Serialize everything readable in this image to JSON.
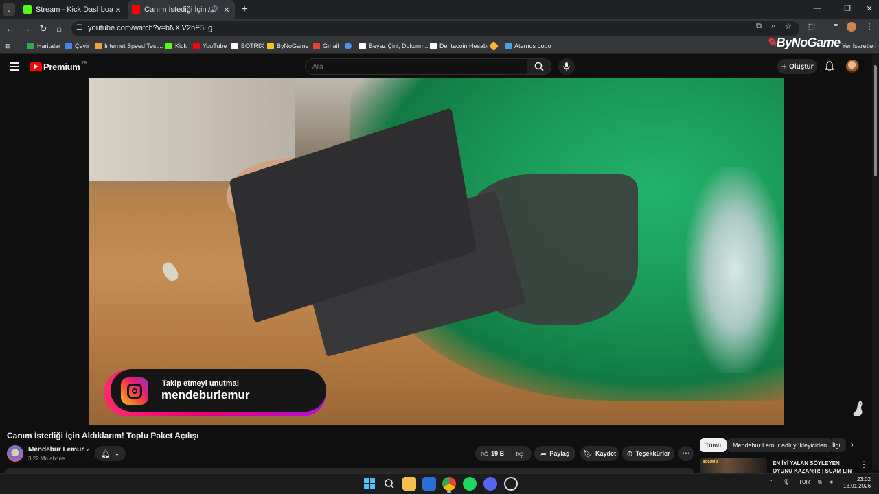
{
  "browser": {
    "tabs": [
      {
        "title": "Stream - Kick Dashboard",
        "favicon_color": "#53fc18"
      },
      {
        "title": "Canım İstediği İçin Aldıklarım!",
        "favicon_color": "#ff0000"
      }
    ],
    "url": "youtube.com/watch?v=bNXiV2hF5Lg",
    "bookmarks": [
      {
        "label": "Haritalar",
        "icon_color": "#34a853"
      },
      {
        "label": "Çevir",
        "icon_color": "#4285f4"
      },
      {
        "label": "Internet Speed Test...",
        "icon_color": "#f4a340"
      },
      {
        "label": "Kick",
        "icon_color": "#53fc18"
      },
      {
        "label": "YouTube",
        "icon_color": "#ff0000"
      },
      {
        "label": "BOTRIX",
        "icon_color": "#ffffff"
      },
      {
        "label": "ByNoGame",
        "icon_color": "#f5c518"
      },
      {
        "label": "Gmail",
        "icon_color": "#ea4335"
      },
      {
        "label": "",
        "icon_color": "#4f8ff0"
      },
      {
        "label": "Beyaz Çini, Dokunm...",
        "icon_color": "#ffffff"
      },
      {
        "label": "Dentacoin Hesabı",
        "icon_color": "#ffffff"
      },
      {
        "label": "",
        "icon_color": "#f3ba2f"
      },
      {
        "label": "Aternos Logo",
        "icon_color": "#4aa3df"
      }
    ],
    "bynogame_logo": "ByNoGame",
    "other_bookmarks": "Yer İşaretleri"
  },
  "youtube": {
    "logo_text": "Premium",
    "region": "TR",
    "search_placeholder": "Ara",
    "create_label": "Oluştur"
  },
  "video": {
    "overlay_line1": "Takip etmeyi unutma!",
    "overlay_line2": "mendeburlemur",
    "title": "Canım İstediği İçin Aldıklarım! Toplu Paket Açılışı",
    "channel": "Mendebur Lemur",
    "subscribers": "3,22 Mn abone",
    "likes": "19 B",
    "share_label": "Paylaş",
    "save_label": "Kaydet",
    "thanks_label": "Teşekkürler"
  },
  "chips": [
    "Tümü",
    "Mendebur Lemur adlı yükleyiciden",
    "İlgil"
  ],
  "recommendation": {
    "title": "EN İYİ YALAN SÖYLEYEN OYUNU KAZANIR! | SCAM LIN",
    "thumb_tag": "BÖLÜM 1"
  },
  "taskbar": {
    "language": "TUR",
    "time": "23:02",
    "date": "18.01.2026"
  },
  "colors": {
    "accent_red": "#ff0000",
    "background": "#0f0f0f",
    "kick_green": "#53fc18"
  }
}
